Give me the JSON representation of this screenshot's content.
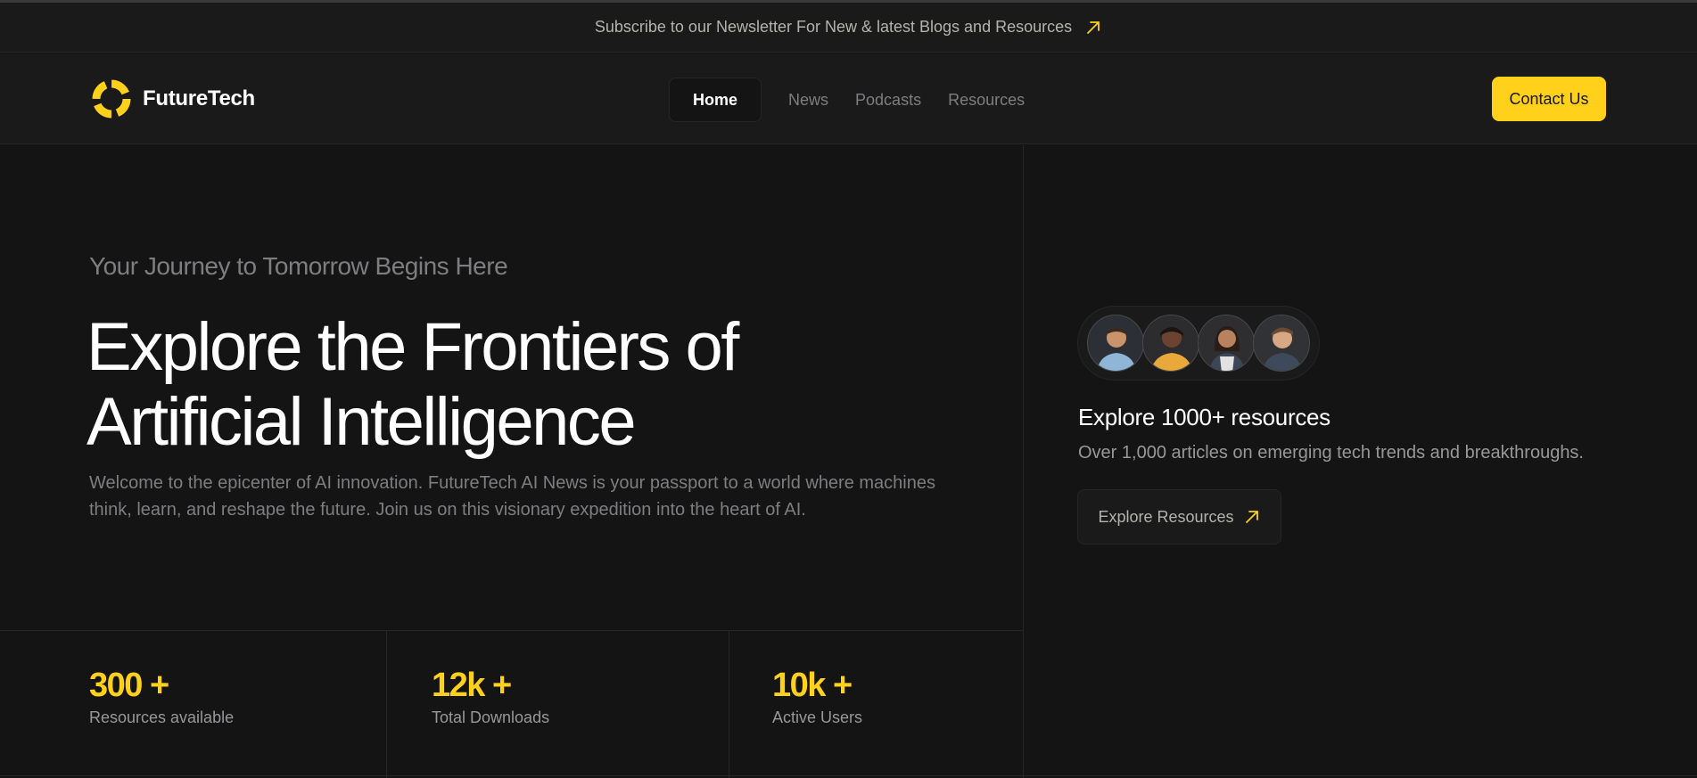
{
  "banner": {
    "text": "Subscribe to our Newsletter For New & latest Blogs and Resources",
    "icon": "arrow-up-right-icon"
  },
  "brand": {
    "name": "FutureTech",
    "accent": "#ffd11a"
  },
  "nav": {
    "items": [
      {
        "label": "Home",
        "active": true
      },
      {
        "label": "News"
      },
      {
        "label": "Podcasts"
      },
      {
        "label": "Resources"
      }
    ]
  },
  "header": {
    "contact_label": "Contact Us"
  },
  "hero": {
    "eyebrow": "Your Journey to Tomorrow Begins Here",
    "headline_line1": "Explore the Frontiers of",
    "headline_line2": "Artificial Intelligence",
    "intro": "Welcome to the epicenter of AI innovation. FutureTech AI News is your passport to a world where machines think, learn, and reshape the future. Join us on this visionary expedition into the heart of AI."
  },
  "stats": [
    {
      "value": "300 +",
      "label": "Resources available"
    },
    {
      "value": "12k +",
      "label": "Total Downloads"
    },
    {
      "value": "10k +",
      "label": "Active Users"
    }
  ],
  "resources": {
    "title": "Explore 1000+ resources",
    "description": "Over 1,000 articles on emerging tech trends and breakthroughs.",
    "button_label": "Explore Resources"
  }
}
